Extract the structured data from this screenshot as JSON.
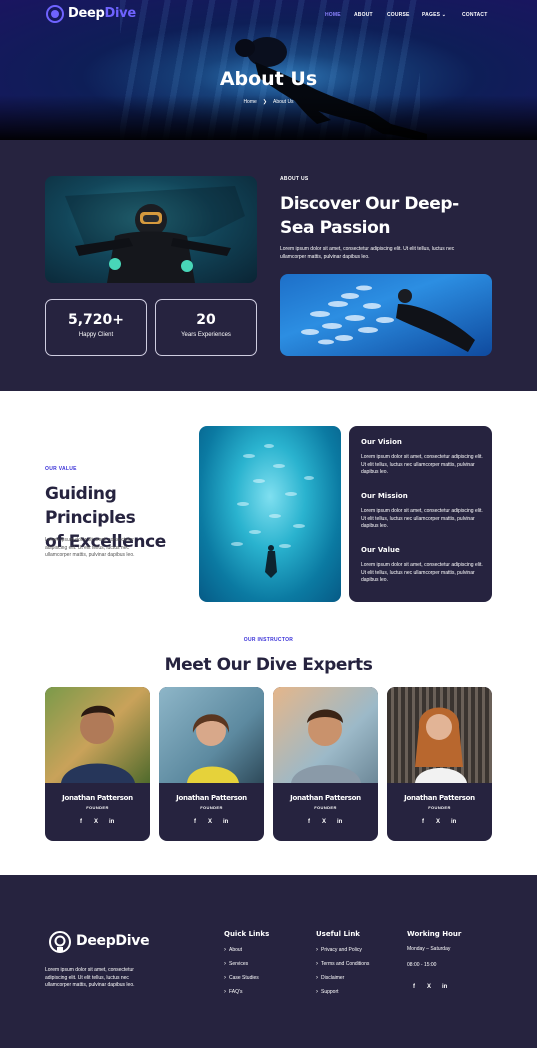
{
  "brand": {
    "name_part1": "Deep",
    "name_part2": "Dive",
    "footer_name": "DeepDive"
  },
  "nav": {
    "items": [
      {
        "label": "HOME",
        "active": true
      },
      {
        "label": "ABOUT"
      },
      {
        "label": "COURSE"
      },
      {
        "label": "PAGES",
        "dropdown": true
      },
      {
        "label": "CONTACT"
      }
    ]
  },
  "hero": {
    "title": "About Us",
    "breadcrumb": {
      "home": "Home",
      "separator": "❯",
      "current": "About Us"
    }
  },
  "about": {
    "kicker": "ABOUT US",
    "heading_line1": "Discover Our Deep-",
    "heading_line2": "Sea Passion",
    "text_line1": "Lorem ipsum dolor sit amet, consectetur adipiscing elit. Ut elit tellus, luctus nec",
    "text_line2": "ullamcorper mattis, pulvinar dapibus leo.",
    "stats": [
      {
        "number": "5,720+",
        "label": "Happy Client"
      },
      {
        "number": "20",
        "label": "Years Experiences"
      }
    ]
  },
  "values": {
    "kicker": "OUR VALUE",
    "heading_line1": "Guiding Principles",
    "heading_line2": "of Excellence",
    "text_line1": "Lorem ipsum dolor sit amet, consectetur",
    "text_line2": "adipiscing elit. Ut elit tellus, luctus nec",
    "text_line3": "ullamcorper mattis, pulvinar dapibus leo.",
    "items": [
      {
        "title": "Our Vision",
        "line1": "Lorem ipsum dolor sit amet, consectetur adipiscing elit.",
        "line2": "Ut elit tellus, luctus nec ullamcorper mattis, pulvinar",
        "line3": "dapibus leo."
      },
      {
        "title": "Our Mission",
        "line1": "Lorem ipsum dolor sit amet, consectetur adipiscing elit.",
        "line2": "Ut elit tellus, luctus nec ullamcorper mattis, pulvinar",
        "line3": "dapibus leo."
      },
      {
        "title": "Our Value",
        "line1": "Lorem ipsum dolor sit amet, consectetur adipiscing elit.",
        "line2": "Ut elit tellus, luctus nec ullamcorper mattis, pulvinar",
        "line3": "dapibus leo."
      }
    ]
  },
  "team": {
    "kicker": "OUR INSTRUCTOR",
    "heading": "Meet Our Dive Experts",
    "members": [
      {
        "name": "Jonathan Patterson",
        "role": "FOUNDER"
      },
      {
        "name": "Jonathan Patterson",
        "role": "FOUNDER"
      },
      {
        "name": "Jonathan Patterson",
        "role": "FOUNDER"
      },
      {
        "name": "Jonathan Patterson",
        "role": "FOUNDER"
      }
    ],
    "social": {
      "facebook": "f",
      "x": "X",
      "linkedin": "in"
    }
  },
  "footer": {
    "text_line1": "Lorem ipsum dolor sit amet, consectetur",
    "text_line2": "adipiscing elit. Ut elit tellus, luctus nec",
    "text_line3": "ullamcorper mattis, pulvinar dapibus leo.",
    "quick_links": {
      "title": "Quick Links",
      "items": [
        "About",
        "Services",
        "Case Studies",
        "FAQ's"
      ]
    },
    "useful_link": {
      "title": "Useful Link",
      "items": [
        "Privacy and Policy",
        "Terms and Conditions",
        "Disclaimer",
        "Support"
      ]
    },
    "working_hour": {
      "title": "Working Hour",
      "days": "Monday – Saturday",
      "hours": "08:00 - 15:00"
    }
  },
  "colors": {
    "accent": "#6f63ff",
    "dark": "#26233f",
    "white": "#ffffff"
  }
}
